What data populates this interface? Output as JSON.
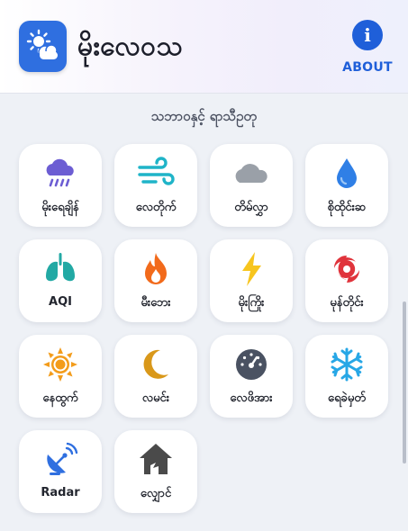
{
  "header": {
    "title": "မိုးလေဝသ",
    "about_label": "ABOUT"
  },
  "section_title": "သဘာဝနှင့် ရာသီဥတု",
  "tiles": [
    {
      "label": "မိုးရေချိန်",
      "icon": "rain-cloud-icon"
    },
    {
      "label": "လေတိုက်",
      "icon": "wind-icon"
    },
    {
      "label": "တိမ်လွှာ",
      "icon": "cloud-icon"
    },
    {
      "label": "စိုထိုင်းဆ",
      "icon": "water-drop-icon"
    },
    {
      "label": "AQI",
      "icon": "lungs-icon"
    },
    {
      "label": "မီးဘေး",
      "icon": "fire-icon"
    },
    {
      "label": "မိုးကြိုး",
      "icon": "lightning-icon"
    },
    {
      "label": "မုန်တိုင်း",
      "icon": "cyclone-icon"
    },
    {
      "label": "နေထွက်",
      "icon": "sun-icon"
    },
    {
      "label": "လမင်း",
      "icon": "moon-icon"
    },
    {
      "label": "လေဖိအား",
      "icon": "barometer-icon"
    },
    {
      "label": "ရေခဲမှတ်",
      "icon": "snowflake-icon"
    },
    {
      "label": "Radar",
      "icon": "radar-dish-icon"
    },
    {
      "label": "လျှောင်",
      "icon": "shelter-icon"
    }
  ],
  "colors": {
    "primary": "#1f5fd9",
    "rain": "#6c5dd3",
    "wind": "#1fb4c8",
    "cloud": "#9aa0a8",
    "drop": "#2f7fe6",
    "lungs": "#22a9a4",
    "fire": "#f26a1b",
    "lightning": "#f7c51e",
    "cyclone": "#e0343c",
    "sun": "#f39c1b",
    "moon": "#d9981a",
    "gauge": "#4a5262",
    "snow": "#27a7e6",
    "radar": "#2f6fe0",
    "house": "#4a4a4a"
  }
}
